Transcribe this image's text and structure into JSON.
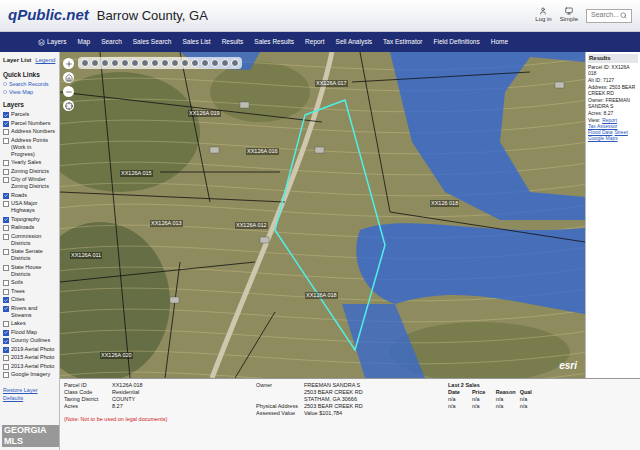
{
  "header": {
    "logo": "qPublic.net",
    "county": "Barrow County, GA",
    "links": [
      "Log in",
      "Simple"
    ],
    "search_placeholder": "Search..."
  },
  "nav": [
    "Layers",
    "Map",
    "Search",
    "Sales Search",
    "Sales List",
    "Results",
    "Sales Results",
    "Report",
    "Sell Analysis",
    "Tax Estimator",
    "Field Definitions",
    "Home"
  ],
  "sidebar": {
    "tabs": [
      {
        "label": "Layer List",
        "selected": true
      },
      {
        "label": "Legend",
        "selected": false
      }
    ],
    "quick_links_title": "Quick Links",
    "quick_links": [
      "Search Records",
      "View Map"
    ],
    "layers_title": "Layers",
    "layers": [
      {
        "label": "Parcels",
        "checked": true
      },
      {
        "label": "Parcel Numbers",
        "checked": true
      },
      {
        "label": "Address Numbers",
        "checked": false
      },
      {
        "label": "Address Points (Work in Progress)",
        "checked": false
      },
      {
        "label": "Yearly Sales",
        "checked": false
      },
      {
        "label": "Zoning Districts",
        "checked": false
      },
      {
        "label": "City of Winder Zoning Districts",
        "checked": false
      },
      {
        "label": "Roads",
        "checked": true
      },
      {
        "label": "USA Major Highways",
        "checked": false
      },
      {
        "label": "Topography",
        "checked": true
      },
      {
        "label": "Railroads",
        "checked": false
      },
      {
        "label": "Commission Districts",
        "checked": false
      },
      {
        "label": "State Senate Districts",
        "checked": false
      },
      {
        "label": "State House Districts",
        "checked": false
      },
      {
        "label": "Soils",
        "checked": false
      },
      {
        "label": "Trees",
        "checked": false
      },
      {
        "label": "Cities",
        "checked": true
      },
      {
        "label": "Rivers and Streams",
        "checked": true
      },
      {
        "label": "Lakes",
        "checked": false
      },
      {
        "label": "Flood Map",
        "checked": true
      },
      {
        "label": "County Outlines",
        "checked": true
      },
      {
        "label": "2019 Aerial Photo",
        "checked": true
      },
      {
        "label": "2015 Aerial Photo",
        "checked": false
      },
      {
        "label": "2013 Aerial Photo",
        "checked": false
      },
      {
        "label": "Google Imagery",
        "checked": false
      }
    ],
    "restore": "Restore Layer Defaults"
  },
  "map": {
    "labels": [
      "XX126A 017",
      "XX126A 019",
      "XX126A 016",
      "XX126A 015",
      "XX126A 013",
      "XX126A 012",
      "XX126A 011",
      "XX126A 018",
      "XX126 018",
      "XX126A 020"
    ],
    "esri": "esri"
  },
  "results": {
    "title": "Results",
    "fields": [
      {
        "label": "Parcel ID",
        "value": "XX126A 018"
      },
      {
        "label": "Alt ID",
        "value": "7127"
      },
      {
        "label": "Address",
        "value": "2503 BEAR CREEK RD"
      },
      {
        "label": "Owner",
        "value": "FREEMAN SANDRA S"
      },
      {
        "label": "Acres",
        "value": "8.27"
      }
    ],
    "view_label": "View:",
    "links": [
      "Report",
      "Tax Assessor",
      "Flood Data",
      "Street",
      "Google Maps"
    ]
  },
  "info": {
    "left": [
      {
        "label": "Parcel ID",
        "value": "XX126A 018"
      },
      {
        "label": "Class Code",
        "value": "Residential"
      },
      {
        "label": "Taxing District",
        "value": "COUNTY"
      },
      {
        "label": "Acres",
        "value": "8.27"
      }
    ],
    "note": "(Note: Not to be used on legal documents)",
    "owner_label": "Owner",
    "owner_lines": [
      "FREEMAN SANDRA S",
      "2503 BEAR CREEK RD",
      "STATHAM, GA 30666"
    ],
    "physical_label": "Physical Address",
    "physical_value": "2503 BEAR CREEK RD",
    "assessed_label": "Assessed Value",
    "assessed_value": "Value $101,784",
    "sales_title": "Last 2 Sales",
    "sales_columns": [
      "Date",
      "Price",
      "Reason",
      "Qual"
    ],
    "sales_rows": [
      [
        "n/a",
        "n/a",
        "n/a",
        "n/a"
      ],
      [
        "n/a",
        "n/a",
        "n/a",
        "n/a"
      ]
    ]
  },
  "watermark": "GEORGIA MLS"
}
